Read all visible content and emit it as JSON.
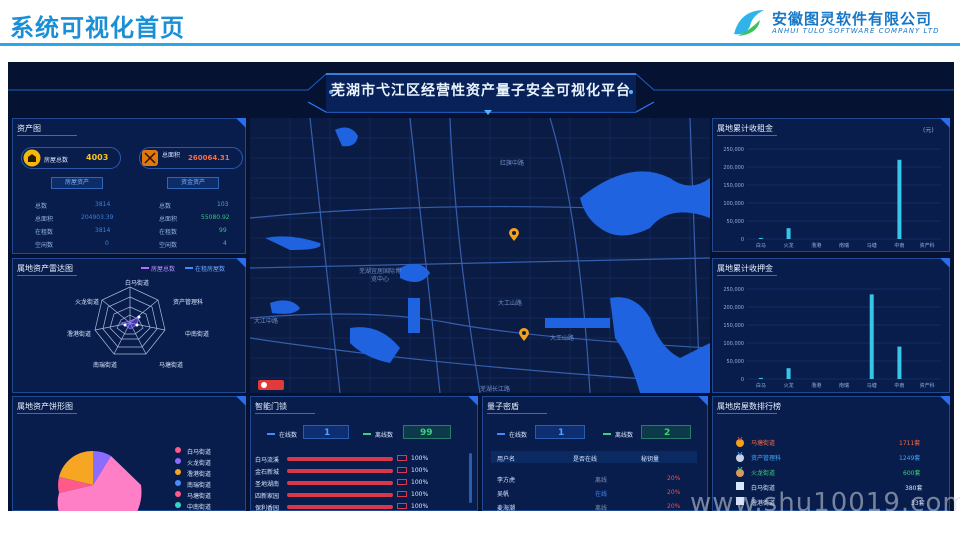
{
  "header": {
    "page_title": "系统可视化首页",
    "logo_cn": "安徽图灵软件有限公司",
    "logo_en": "ANHUI TULO SOFTWARE COMPANY LTD"
  },
  "banner_title": "芜湖市弋江区经营性资产量子安全可视化平台",
  "assets": {
    "title": "资产图",
    "house_label": "房屋总数",
    "house_value": "4003",
    "area_label": "总面积",
    "area_value": "260064.31",
    "btn_left": "房屋资产",
    "btn_right": "资金资产",
    "left_rows": [
      {
        "label": "总数",
        "value": "3814"
      },
      {
        "label": "总面积",
        "value": "204903.39"
      },
      {
        "label": "在租数",
        "value": "3814"
      },
      {
        "label": "空闲数",
        "value": "0"
      }
    ],
    "right_rows": [
      {
        "label": "总数",
        "value": "103"
      },
      {
        "label": "总面积",
        "value": "55080.92"
      },
      {
        "label": "在租数",
        "value": "99"
      },
      {
        "label": "空闲数",
        "value": "4"
      }
    ]
  },
  "radar": {
    "title": "属地资产雷达图",
    "legend1": "房屋总数",
    "legend2": "在租房屋数",
    "labels": [
      "白马街道",
      "资产管理科",
      "中南街道",
      "马塘街道",
      "南瑞街道",
      "澛港街道",
      "火龙街道"
    ]
  },
  "pie": {
    "title": "属地资产饼形图",
    "legend": [
      {
        "name": "白马街道",
        "color": "#ff5a8a"
      },
      {
        "name": "火龙街道",
        "color": "#8a6cff"
      },
      {
        "name": "澛港街道",
        "color": "#f6a623"
      },
      {
        "name": "南瑞街道",
        "color": "#4a8dff"
      },
      {
        "name": "马塘街道",
        "color": "#ff5a8a"
      },
      {
        "name": "中南街道",
        "color": "#39d3c9"
      }
    ]
  },
  "map": {
    "labels": [
      "红旗中路",
      "芜湖宜居国际博览中心",
      "大江中路",
      "大工山路",
      "大工山路",
      "芜湖长江路"
    ]
  },
  "rent": {
    "title": "属地累计收租金",
    "unit": "(元)"
  },
  "deposit": {
    "title": "属地累计收押金"
  },
  "smartlock": {
    "title": "智能门锁",
    "online_label": "在线数",
    "online_value": "1",
    "offline_label": "离线数",
    "offline_value": "99",
    "rows": [
      {
        "name": "白马流溪",
        "pct": "100%"
      },
      {
        "name": "金石新城",
        "pct": "100%"
      },
      {
        "name": "圣地湖南",
        "pct": "100%"
      },
      {
        "name": "四新家园",
        "pct": "100%"
      },
      {
        "name": "保利香园",
        "pct": "100%"
      }
    ]
  },
  "qkey": {
    "title": "量子密盾",
    "online_label": "在线数",
    "online_value": "1",
    "offline_label": "离线数",
    "offline_value": "2",
    "col1": "用户名",
    "col2": "是否在线",
    "col3": "秘钥量",
    "rows": [
      {
        "user": "李方虎",
        "status": "离线",
        "pct": "20%",
        "online": false
      },
      {
        "user": "吴帆",
        "status": "在线",
        "pct": "20%",
        "online": true
      },
      {
        "user": "麦海潮",
        "status": "离线",
        "pct": "20%",
        "online": false
      }
    ]
  },
  "ranking": {
    "title": "属地房屋数排行榜",
    "rows": [
      {
        "name": "马塘街道",
        "value": "1711套",
        "color": "#ff6a3d"
      },
      {
        "name": "资产管理科",
        "value": "1249套",
        "color": "#3fa9ff"
      },
      {
        "name": "火龙街道",
        "value": "600套",
        "color": "#39d37a"
      },
      {
        "name": "白马街道",
        "value": "380套",
        "color": "#d9e6ff"
      },
      {
        "name": "澛港街道",
        "value": "33套",
        "color": "#d9e6ff"
      }
    ]
  },
  "watermark": "www.shu10019.com",
  "chart_data": [
    {
      "type": "bar",
      "title": "属地累计收租金",
      "categories": [
        "白马",
        "火龙",
        "澛港",
        "南瑞",
        "马塘",
        "中南",
        "资产科"
      ],
      "values": [
        3000,
        30000,
        0,
        0,
        0,
        220000,
        0
      ],
      "ylim": [
        0,
        250000
      ],
      "yticks": [
        "250,000",
        "200,000",
        "150,000",
        "100,000",
        "50,000",
        "0"
      ]
    },
    {
      "type": "bar",
      "title": "属地累计收押金",
      "categories": [
        "白马",
        "火龙",
        "澛港",
        "南瑞",
        "马塘",
        "中南",
        "资产科"
      ],
      "values": [
        3000,
        30000,
        0,
        0,
        235000,
        90000,
        0
      ],
      "ylim": [
        0,
        250000
      ],
      "yticks": [
        "250,000",
        "200,000",
        "150,000",
        "100,000",
        "50,000",
        "0"
      ]
    }
  ]
}
